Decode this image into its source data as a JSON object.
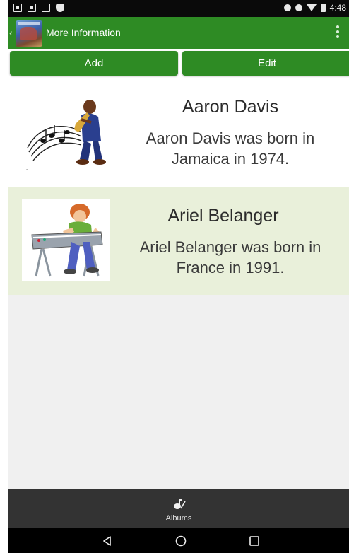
{
  "status_bar": {
    "time": "4:48",
    "left_icons": [
      "gmail-icon",
      "image-icon",
      "sd-card-icon",
      "android-icon"
    ],
    "right_icons": [
      "location-icon",
      "dnd-icon",
      "wifi-icon",
      "battery-icon"
    ]
  },
  "app_bar": {
    "title": "More Information",
    "back_glyph": "‹",
    "logo": "album-cover-logo",
    "menu_icon": "overflow-menu-icon"
  },
  "actions": {
    "add_label": "Add",
    "edit_label": "Edit"
  },
  "artists": [
    {
      "name": "Aaron Davis",
      "description": "Aaron Davis was born in Jamaica in 1974.",
      "image": "saxophone-player-illustration"
    },
    {
      "name": "Ariel Belanger",
      "description": "Ariel Belanger was born in France in 1991.",
      "image": "keyboard-player-illustration"
    }
  ],
  "tabs": [
    {
      "label": "Albums",
      "icon": "music-note-icon"
    }
  ],
  "nav_bar": {
    "buttons": [
      "back-triangle-icon",
      "home-circle-icon",
      "recents-square-icon"
    ]
  },
  "colors": {
    "accent": "#2e8b24",
    "selected_row": "#e9f0da",
    "tab_bar": "#333333"
  }
}
